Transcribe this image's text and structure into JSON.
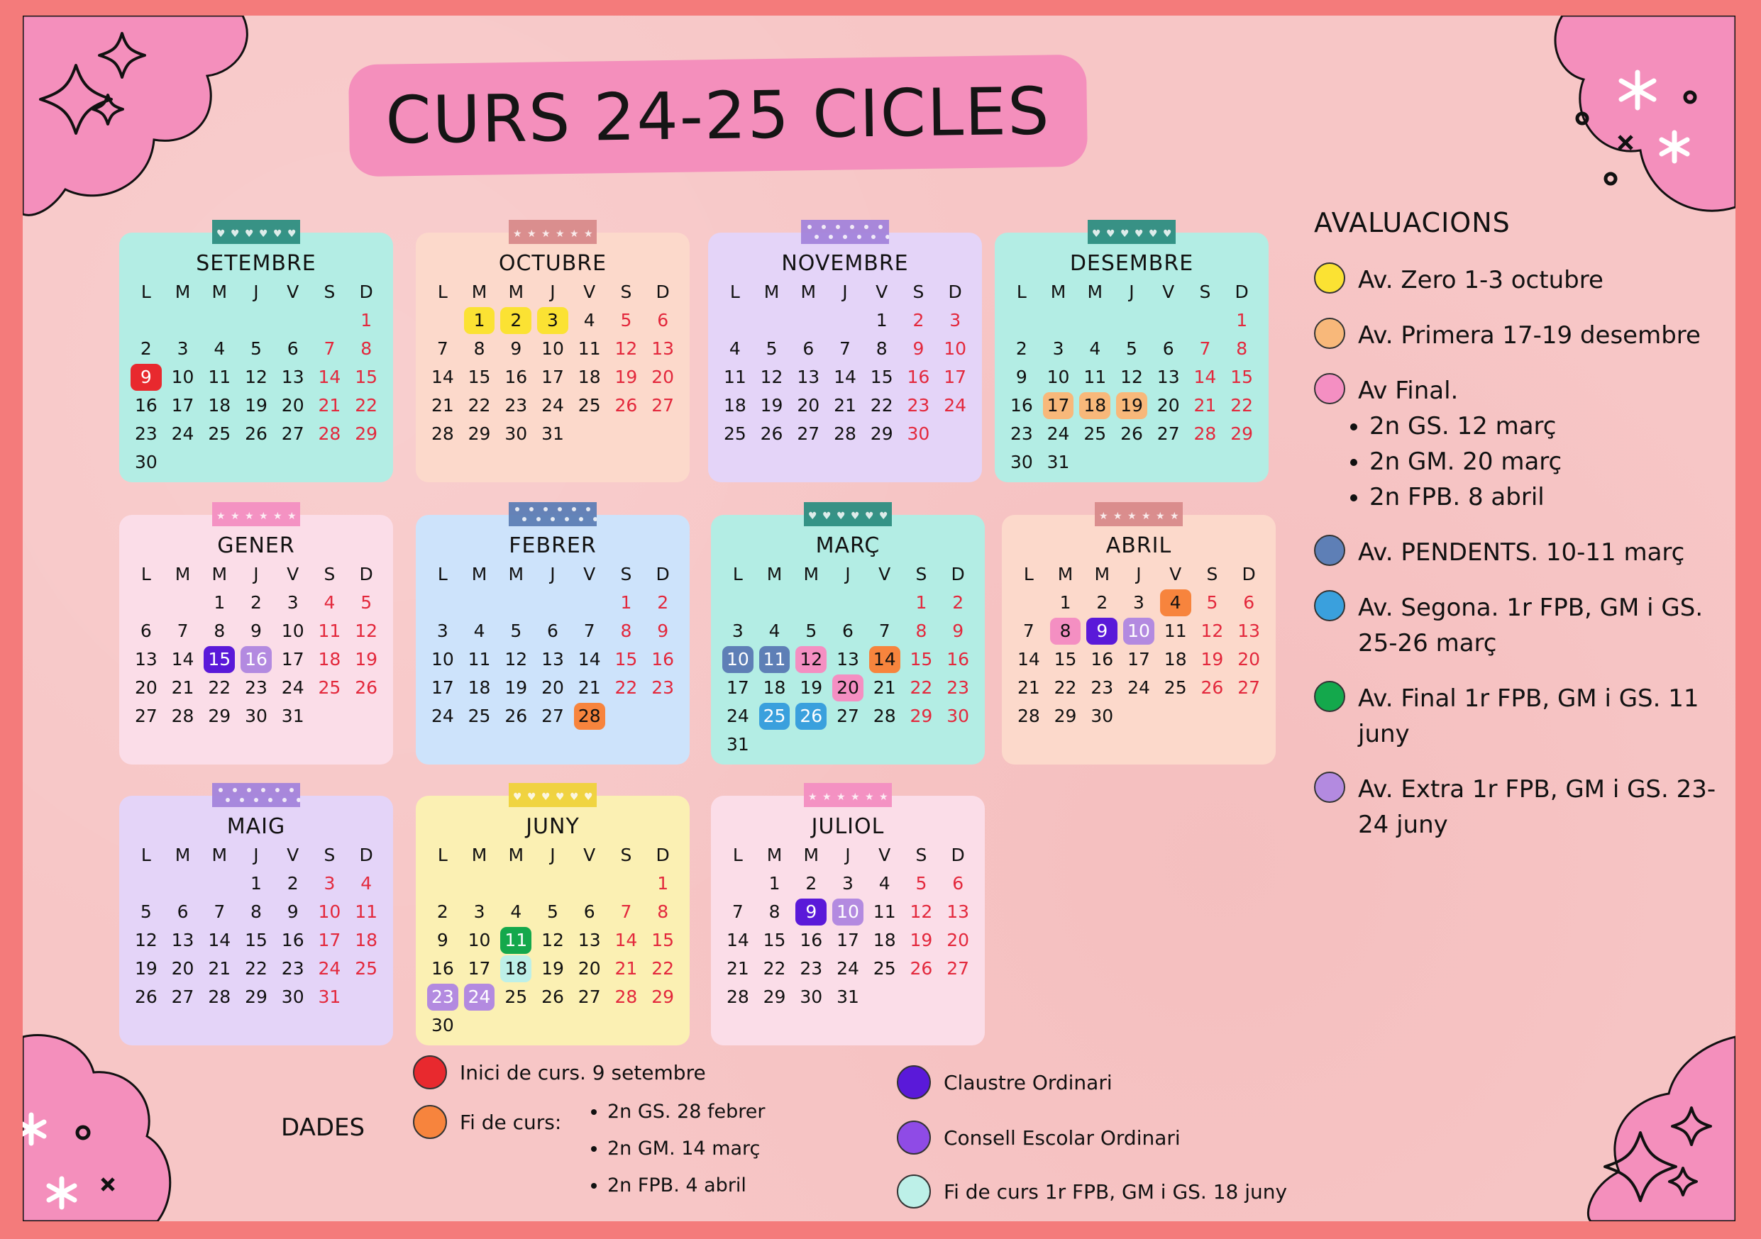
{
  "title": "CURS 24-25 CICLES",
  "weekday_headers": [
    "L",
    "M",
    "M",
    "J",
    "V",
    "S",
    "D"
  ],
  "colors": {
    "red": "#e8292e",
    "orange": "#f7843d",
    "yellow": "#fbe233",
    "peach": "#f8b87a",
    "pink": "#f48fc2",
    "steel_blue": "#5e7fb6",
    "sky_blue": "#3aa0dd",
    "green": "#14a84c",
    "light_purple": "#b38ae0",
    "dark_purple": "#5a19d9",
    "violet": "#8f4be6",
    "light_cyan": "#bdf0e8"
  },
  "months": [
    {
      "name": "SETEMBRE",
      "bg": "#b3ede4",
      "tape": "#2e8f82",
      "offset": 6,
      "days": 30,
      "highlights": {
        "9": "#e8292e"
      }
    },
    {
      "name": "OCTUBRE",
      "bg": "#fcd9cb",
      "tape": "#d98b8b",
      "offset": 1,
      "days": 31,
      "highlights": {
        "1": "#fbe233",
        "2": "#fbe233",
        "3": "#fbe233"
      }
    },
    {
      "name": "NOVEMBRE",
      "bg": "#e4d4f8",
      "tape": "#a484dc",
      "offset": 4,
      "days": 30,
      "highlights": {}
    },
    {
      "name": "DESEMBRE",
      "bg": "#b3ede4",
      "tape": "#2e8f82",
      "offset": 6,
      "days": 31,
      "highlights": {
        "17": "#f8b87a",
        "18": "#f8b87a",
        "19": "#f8b87a"
      }
    },
    {
      "name": "GENER",
      "bg": "#fbdde8",
      "tape": "#f48fc2",
      "offset": 2,
      "days": 31,
      "highlights": {
        "15": "#5a19d9",
        "16": "#b38ae0"
      }
    },
    {
      "name": "FEBRER",
      "bg": "#cde3fb",
      "tape": "#5e7fb6",
      "offset": 5,
      "days": 28,
      "highlights": {
        "28": "#f7843d"
      }
    },
    {
      "name": "MARÇ",
      "bg": "#b3ede4",
      "tape": "#2e8f82",
      "offset": 5,
      "days": 31,
      "highlights": {
        "10": "#5e7fb6",
        "11": "#5e7fb6",
        "12": "#f48fc2",
        "14": "#f7843d",
        "20": "#f48fc2",
        "25": "#3aa0dd",
        "26": "#3aa0dd"
      }
    },
    {
      "name": "ABRIL",
      "bg": "#fcd9cb",
      "tape": "#d98b8b",
      "offset": 1,
      "days": 30,
      "highlights": {
        "4": "#f7843d",
        "8": "#f48fc2",
        "9": "#5a19d9",
        "10": "#b38ae0"
      }
    },
    {
      "name": "MAIG",
      "bg": "#e4d4f8",
      "tape": "#a484dc",
      "offset": 3,
      "days": 31,
      "highlights": {}
    },
    {
      "name": "JUNY",
      "bg": "#fbf0b3",
      "tape": "#f0d33a",
      "offset": 6,
      "days": 30,
      "highlights": {
        "11": "#14a84c",
        "18": "#bdf0e8",
        "23": "#b38ae0",
        "24": "#b38ae0"
      }
    },
    {
      "name": "JULIOL",
      "bg": "#fbdde8",
      "tape": "#f48fc2",
      "offset": 1,
      "days": 31,
      "highlights": {
        "9": "#5a19d9",
        "10": "#b38ae0"
      }
    }
  ],
  "avaluacions": {
    "title": "AVALUACIONS",
    "items": [
      {
        "color": "#fbe233",
        "text": "Av. Zero 1-3 octubre"
      },
      {
        "color": "#f8b87a",
        "text": "Av. Primera 17-19 desembre"
      },
      {
        "color": "#f48fc2",
        "text": "Av Final.",
        "sub": [
          "2n GS. 12 març",
          "2n GM. 20 març",
          "2n FPB. 8 abril"
        ]
      },
      {
        "color": "#5e7fb6",
        "text": "Av. PENDENTS. 10-11 març"
      },
      {
        "color": "#3aa0dd",
        "text": "Av. Segona. 1r FPB, GM i GS. 25-26 març"
      },
      {
        "color": "#14a84c",
        "text": "Av. Final 1r FPB, GM i GS. 11 juny"
      },
      {
        "color": "#b38ae0",
        "text": "Av. Extra 1r FPB, GM i GS. 23-24 juny"
      }
    ]
  },
  "dades": {
    "label": "DADES",
    "inici": "Inici de curs. 9 setembre",
    "fi_label": "Fi de curs:",
    "fi_items": [
      "2n GS. 28 febrer",
      "2n GM. 14 març",
      "2n FPB. 4 abril"
    ],
    "claustre": "Claustre Ordinari",
    "consell": "Consell Escolar Ordinari",
    "fi_1r": "Fi de curs 1r FPB, GM i GS. 18 juny"
  }
}
